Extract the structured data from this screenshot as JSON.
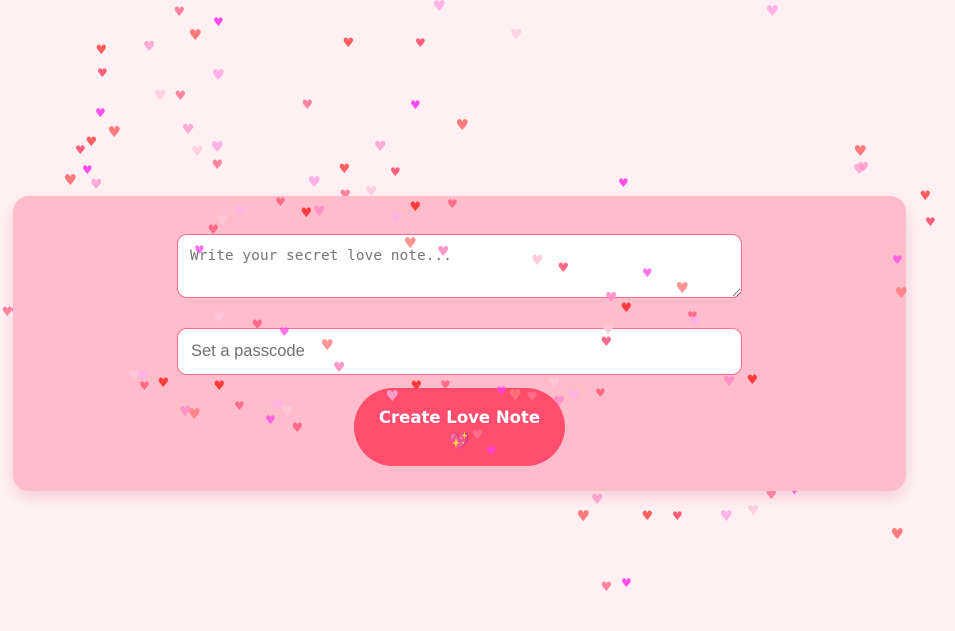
{
  "form": {
    "note_placeholder": "Write your secret love note...",
    "passcode_placeholder": "Set a passcode",
    "create_label": "Create Love Note",
    "create_emoji": "💖"
  },
  "decoration": {
    "icon": "heart-icon",
    "glyph": "♥",
    "colors": [
      "#ff4d6d",
      "#ff6b8b",
      "#ff8fc7",
      "#ffb3e6",
      "#ff3cf0",
      "#ff3b3b",
      "#ffc6da",
      "#ff7b7b"
    ]
  }
}
